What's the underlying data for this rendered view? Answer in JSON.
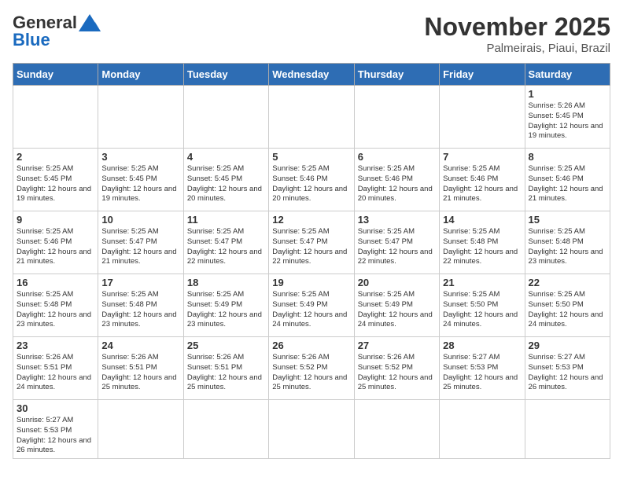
{
  "header": {
    "logo_general": "General",
    "logo_blue": "Blue",
    "month": "November 2025",
    "location": "Palmeirais, Piaui, Brazil"
  },
  "days_of_week": [
    "Sunday",
    "Monday",
    "Tuesday",
    "Wednesday",
    "Thursday",
    "Friday",
    "Saturday"
  ],
  "weeks": [
    [
      {
        "day": "",
        "info": ""
      },
      {
        "day": "",
        "info": ""
      },
      {
        "day": "",
        "info": ""
      },
      {
        "day": "",
        "info": ""
      },
      {
        "day": "",
        "info": ""
      },
      {
        "day": "",
        "info": ""
      },
      {
        "day": "1",
        "info": "Sunrise: 5:26 AM\nSunset: 5:45 PM\nDaylight: 12 hours and 19 minutes."
      }
    ],
    [
      {
        "day": "2",
        "info": "Sunrise: 5:25 AM\nSunset: 5:45 PM\nDaylight: 12 hours and 19 minutes."
      },
      {
        "day": "3",
        "info": "Sunrise: 5:25 AM\nSunset: 5:45 PM\nDaylight: 12 hours and 19 minutes."
      },
      {
        "day": "4",
        "info": "Sunrise: 5:25 AM\nSunset: 5:45 PM\nDaylight: 12 hours and 20 minutes."
      },
      {
        "day": "5",
        "info": "Sunrise: 5:25 AM\nSunset: 5:46 PM\nDaylight: 12 hours and 20 minutes."
      },
      {
        "day": "6",
        "info": "Sunrise: 5:25 AM\nSunset: 5:46 PM\nDaylight: 12 hours and 20 minutes."
      },
      {
        "day": "7",
        "info": "Sunrise: 5:25 AM\nSunset: 5:46 PM\nDaylight: 12 hours and 21 minutes."
      },
      {
        "day": "8",
        "info": "Sunrise: 5:25 AM\nSunset: 5:46 PM\nDaylight: 12 hours and 21 minutes."
      }
    ],
    [
      {
        "day": "9",
        "info": "Sunrise: 5:25 AM\nSunset: 5:46 PM\nDaylight: 12 hours and 21 minutes."
      },
      {
        "day": "10",
        "info": "Sunrise: 5:25 AM\nSunset: 5:47 PM\nDaylight: 12 hours and 21 minutes."
      },
      {
        "day": "11",
        "info": "Sunrise: 5:25 AM\nSunset: 5:47 PM\nDaylight: 12 hours and 22 minutes."
      },
      {
        "day": "12",
        "info": "Sunrise: 5:25 AM\nSunset: 5:47 PM\nDaylight: 12 hours and 22 minutes."
      },
      {
        "day": "13",
        "info": "Sunrise: 5:25 AM\nSunset: 5:47 PM\nDaylight: 12 hours and 22 minutes."
      },
      {
        "day": "14",
        "info": "Sunrise: 5:25 AM\nSunset: 5:48 PM\nDaylight: 12 hours and 22 minutes."
      },
      {
        "day": "15",
        "info": "Sunrise: 5:25 AM\nSunset: 5:48 PM\nDaylight: 12 hours and 23 minutes."
      }
    ],
    [
      {
        "day": "16",
        "info": "Sunrise: 5:25 AM\nSunset: 5:48 PM\nDaylight: 12 hours and 23 minutes."
      },
      {
        "day": "17",
        "info": "Sunrise: 5:25 AM\nSunset: 5:48 PM\nDaylight: 12 hours and 23 minutes."
      },
      {
        "day": "18",
        "info": "Sunrise: 5:25 AM\nSunset: 5:49 PM\nDaylight: 12 hours and 23 minutes."
      },
      {
        "day": "19",
        "info": "Sunrise: 5:25 AM\nSunset: 5:49 PM\nDaylight: 12 hours and 24 minutes."
      },
      {
        "day": "20",
        "info": "Sunrise: 5:25 AM\nSunset: 5:49 PM\nDaylight: 12 hours and 24 minutes."
      },
      {
        "day": "21",
        "info": "Sunrise: 5:25 AM\nSunset: 5:50 PM\nDaylight: 12 hours and 24 minutes."
      },
      {
        "day": "22",
        "info": "Sunrise: 5:25 AM\nSunset: 5:50 PM\nDaylight: 12 hours and 24 minutes."
      }
    ],
    [
      {
        "day": "23",
        "info": "Sunrise: 5:26 AM\nSunset: 5:51 PM\nDaylight: 12 hours and 24 minutes."
      },
      {
        "day": "24",
        "info": "Sunrise: 5:26 AM\nSunset: 5:51 PM\nDaylight: 12 hours and 25 minutes."
      },
      {
        "day": "25",
        "info": "Sunrise: 5:26 AM\nSunset: 5:51 PM\nDaylight: 12 hours and 25 minutes."
      },
      {
        "day": "26",
        "info": "Sunrise: 5:26 AM\nSunset: 5:52 PM\nDaylight: 12 hours and 25 minutes."
      },
      {
        "day": "27",
        "info": "Sunrise: 5:26 AM\nSunset: 5:52 PM\nDaylight: 12 hours and 25 minutes."
      },
      {
        "day": "28",
        "info": "Sunrise: 5:27 AM\nSunset: 5:53 PM\nDaylight: 12 hours and 25 minutes."
      },
      {
        "day": "29",
        "info": "Sunrise: 5:27 AM\nSunset: 5:53 PM\nDaylight: 12 hours and 26 minutes."
      }
    ],
    [
      {
        "day": "30",
        "info": "Sunrise: 5:27 AM\nSunset: 5:53 PM\nDaylight: 12 hours and 26 minutes."
      },
      {
        "day": "",
        "info": ""
      },
      {
        "day": "",
        "info": ""
      },
      {
        "day": "",
        "info": ""
      },
      {
        "day": "",
        "info": ""
      },
      {
        "day": "",
        "info": ""
      },
      {
        "day": "",
        "info": ""
      }
    ]
  ]
}
